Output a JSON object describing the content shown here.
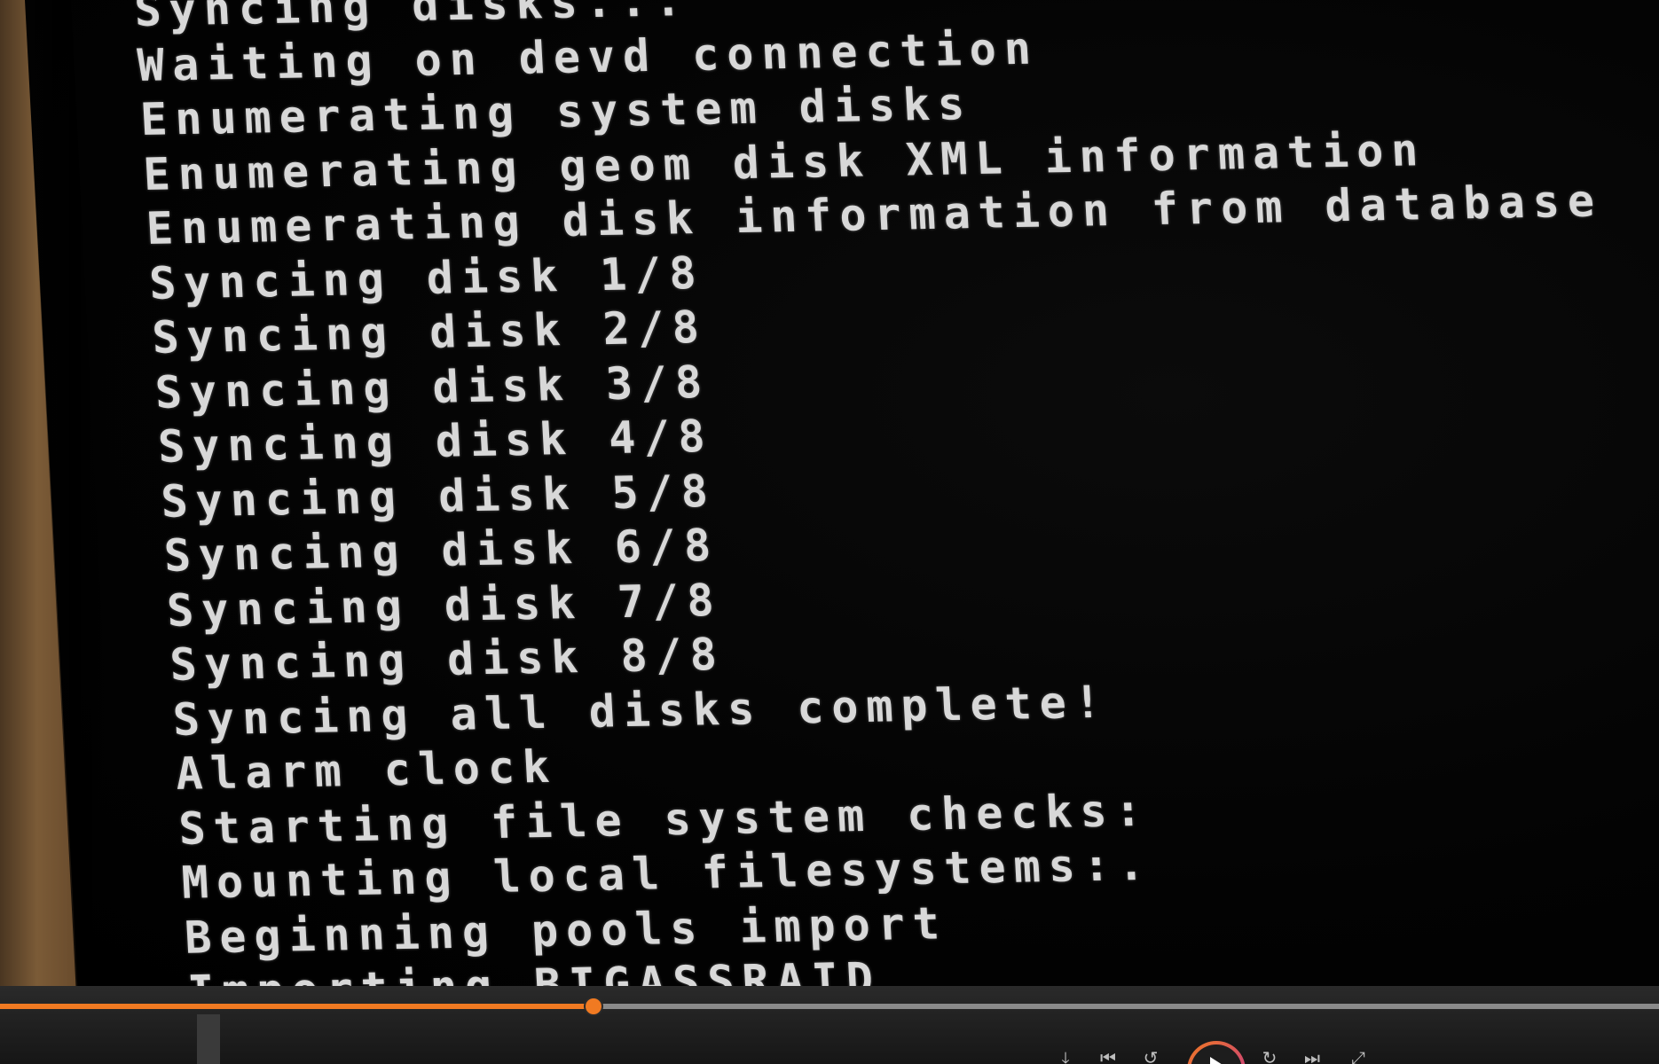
{
  "console": {
    "lines": [
      "Syncing disks...",
      "Waiting on devd connection",
      "Enumerating system disks",
      "Enumerating geom disk XML information",
      "Enumerating disk information from database",
      "Syncing disk 1/8",
      "Syncing disk 2/8",
      "Syncing disk 3/8",
      "Syncing disk 4/8",
      "Syncing disk 5/8",
      "Syncing disk 6/8",
      "Syncing disk 7/8",
      "Syncing disk 8/8",
      "Syncing all disks complete!",
      "Alarm clock",
      "Starting file system checks:",
      "Mounting local filesystems:.",
      "Beginning pools import",
      "Importing BIGASSRAID"
    ]
  },
  "player": {
    "progress": 0.358,
    "accent_color": "#f07a22",
    "play_gradient": [
      "#f07a22",
      "#c2338f"
    ],
    "controls": {
      "skip_back_icon": "skip-back-icon",
      "previous_icon": "previous-icon",
      "rewind_icon": "rewind-icon",
      "play_icon": "play-icon",
      "forward_icon": "forward-icon",
      "next_icon": "next-icon",
      "fullscreen_icon": "fullscreen-icon"
    }
  }
}
